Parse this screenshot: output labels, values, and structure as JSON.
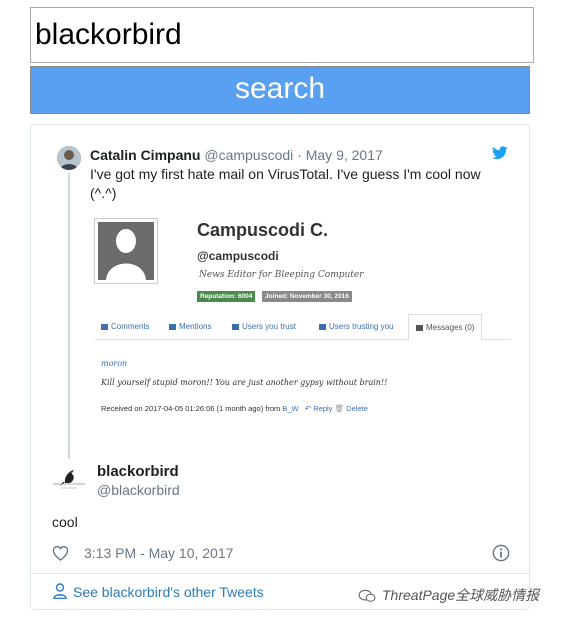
{
  "search": {
    "value": "blackorbird",
    "button_label": "search"
  },
  "parent_tweet": {
    "author_name": "Catalin Cimpanu",
    "author_handle": "@campuscodi",
    "separator": "·",
    "date": "May 9, 2017",
    "text": "I've got my first hate mail on VirusTotal. I've guess I'm cool now (^.^)",
    "embedded_screenshot": {
      "profile_name": "Campuscodi C.",
      "profile_handle": "@campuscodi",
      "profile_role": "News Editor for Bleeping Computer",
      "reputation_badge": "Reputation: 6004",
      "joined_badge": "Joined: November 30, 2016",
      "tabs": [
        {
          "label": "Comments",
          "icon": "comments-icon"
        },
        {
          "label": "Mentions",
          "icon": "quote-icon"
        },
        {
          "label": "Users you trust",
          "icon": "users-icon"
        },
        {
          "label": "Users trusting you",
          "icon": "pencil-icon"
        },
        {
          "label": "Messages (0)",
          "icon": "envelope-icon"
        }
      ],
      "message_from": "moron",
      "message_body": "Kill yourself stupid moron!! You are just another gypsy without brain!!",
      "received_prefix": "Received on 2017-04-05 01:26:06 (1 month ago) from",
      "received_from": "B_W",
      "reply_label": "Reply",
      "delete_label": "Delete"
    }
  },
  "main_tweet": {
    "author_name": "blackorbird",
    "author_handle": "@blackorbird",
    "text": "cool",
    "timestamp": "3:13 PM - May 10, 2017"
  },
  "footer": {
    "other_tweets_label": "See blackorbird's other Tweets"
  },
  "watermark": {
    "text": "ThreatPage全球威胁情报"
  },
  "colors": {
    "search_button": "#5aa0f0",
    "twitter_blue": "#1da1f2",
    "link_blue": "#2b7bb9",
    "muted_text": "#697882"
  }
}
